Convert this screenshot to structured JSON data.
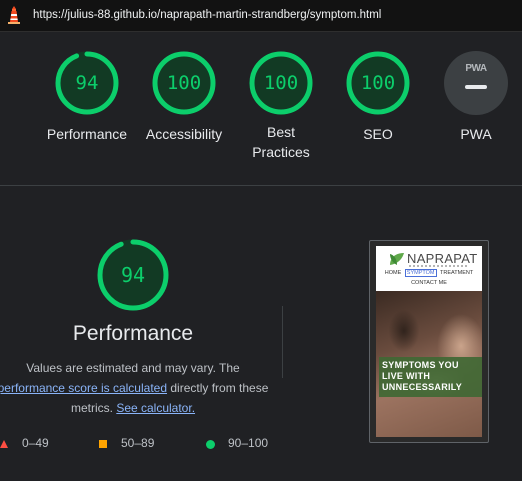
{
  "url": "https://julius-88.github.io/naprapath-martin-strandberg/symptom.html",
  "colors": {
    "pass": "#0cce6b",
    "average": "#ffa400",
    "fail": "#ff4e42",
    "link": "#8ab4f8",
    "background": "#202124"
  },
  "categories": [
    {
      "label": "Performance",
      "score": 94
    },
    {
      "label": "Accessibility",
      "score": 100
    },
    {
      "label": "Best Practices",
      "score": 100
    },
    {
      "label": "SEO",
      "score": 100
    }
  ],
  "pwa": {
    "label": "PWA",
    "badge_text": "PWA",
    "icon": "pwa-badge-icon"
  },
  "performance_detail": {
    "score": 94,
    "title": "Performance",
    "desc_part1": "Values are estimated and may vary. The",
    "desc_link1": "performance score is calculated",
    "desc_part2": "directly from these metrics.",
    "desc_link2": "See calculator."
  },
  "legend": [
    {
      "range": "0–49",
      "icon": "red-triangle-icon"
    },
    {
      "range": "50–89",
      "icon": "orange-square-icon"
    },
    {
      "range": "90–100",
      "icon": "green-circle-icon"
    }
  ],
  "screenshot": {
    "brand": "NAPRAPAT",
    "nav": [
      "HOME",
      "SYMPTOM",
      "TREATMENT"
    ],
    "nav2": "CONTACT ME",
    "hero_line1": "SYMPTOMS YOU",
    "hero_line2": "LIVE WITH",
    "hero_line3": "UNNECESSARILY"
  }
}
